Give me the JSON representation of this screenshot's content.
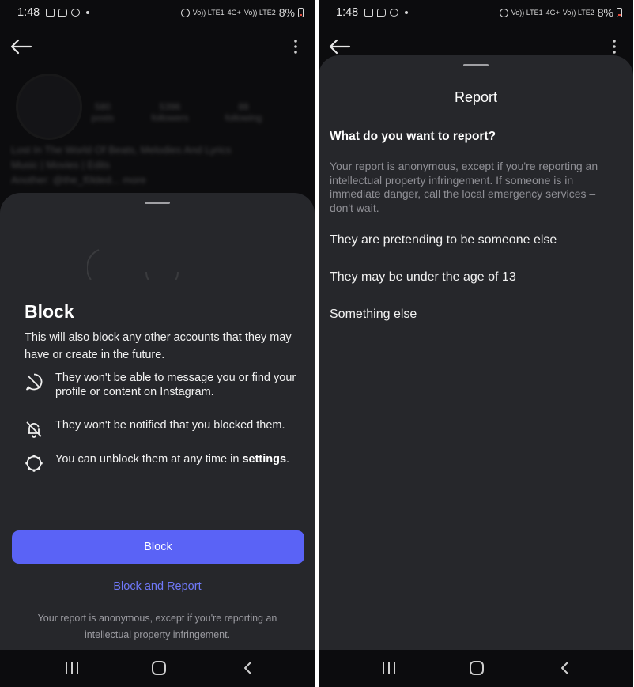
{
  "left": {
    "status": {
      "time": "1:48",
      "battery": "8%",
      "net1": "Vo)) LTE1",
      "net2": "4G+",
      "net3": "Vo)) LTE2"
    },
    "profile": {
      "posts_count": "580",
      "posts_label": "posts",
      "followers_count": "5396",
      "followers_label": "followers",
      "following_count": "88",
      "following_label": "following",
      "bio_line1": "Lost In The World Of Beats, Melodies And Lyrics",
      "bio_line2": "Music | Movies | Edits",
      "bio_line3": "Another: @the_f0lded... more"
    },
    "sheet": {
      "title": "Block",
      "description": "This will also block any other accounts that they may have or create in the future.",
      "item1": "They won't be able to message you or find your profile or content on Instagram.",
      "item2": "They won't be notified that you blocked them.",
      "item3_text": "You can unblock them at any time in ",
      "item3_link": "settings",
      "item3_end": ".",
      "block_button": "Block",
      "block_report_link": "Block and Report",
      "footnote": "Your report is anonymous, except if you're reporting an intellectual property infringement."
    }
  },
  "right": {
    "status": {
      "time": "1:48",
      "battery": "8%",
      "net1": "Vo)) LTE1",
      "net2": "4G+",
      "net3": "Vo)) LTE2"
    },
    "sheet": {
      "title": "Report",
      "question": "What do you want to report?",
      "note": "Your report is anonymous, except if you're reporting an intellectual property infringement. If someone is in immediate danger, call the local emergency services – don't wait.",
      "options": [
        "They are pretending to be someone else",
        "They may be under the age of 13",
        "Something else"
      ]
    }
  },
  "colors": {
    "accent": "#5a63f6",
    "link": "#6f78f8",
    "sheet_bg": "#26272b",
    "screen_bg": "#0c0c0e"
  },
  "icons": {
    "app_back": "arrow-left-icon",
    "app_menu": "more-vertical-icon",
    "nav_recents": "recents-icon",
    "nav_home": "home-icon",
    "nav_back": "back-chevron-icon"
  }
}
